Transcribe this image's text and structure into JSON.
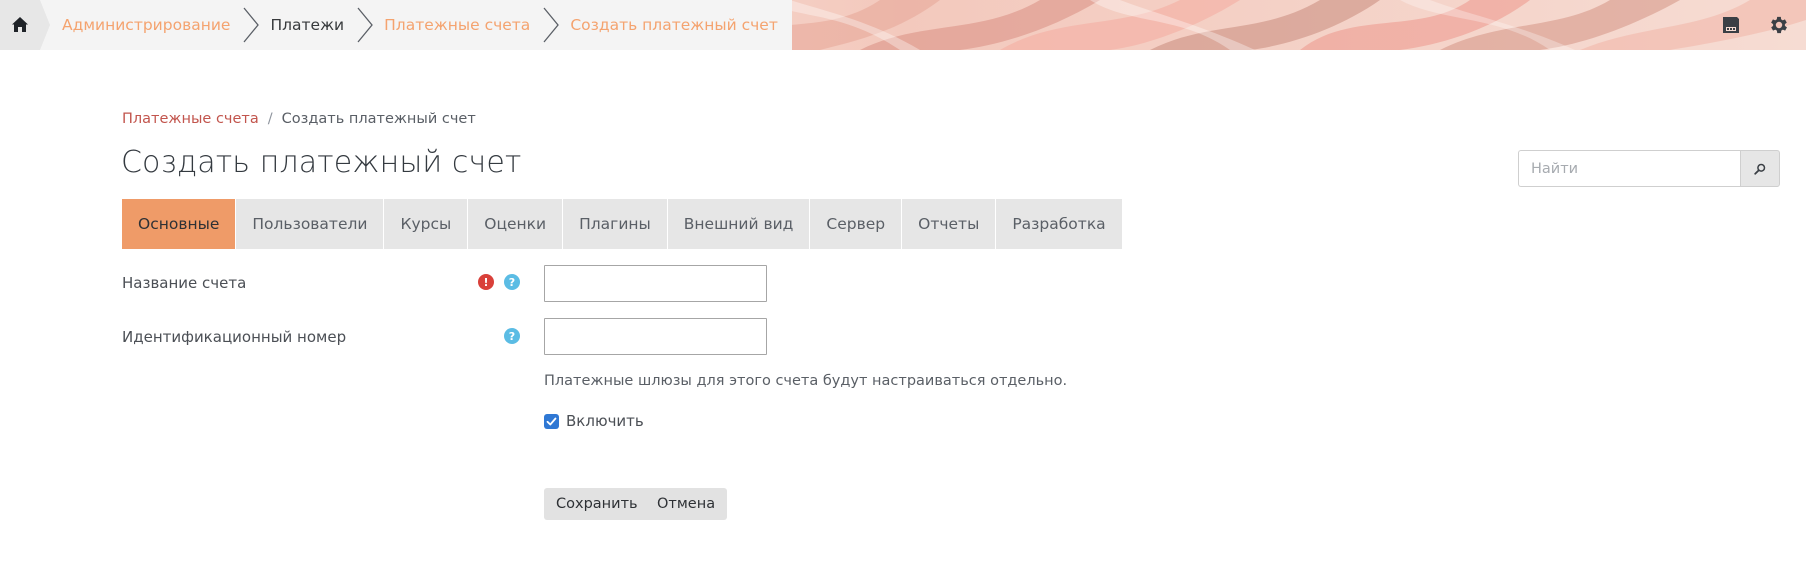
{
  "topbar": {
    "breadcrumbs": [
      {
        "label": "Администрирование",
        "link": true
      },
      {
        "label": "Платежи",
        "link": false
      },
      {
        "label": "Платежные счета",
        "link": true
      },
      {
        "label": "Создать платежный счет",
        "link": true
      }
    ],
    "icons": {
      "home": "home-icon",
      "save": "save-icon",
      "settings": "gear-icon"
    }
  },
  "breadcrumb": {
    "parent": "Платежные счета",
    "separator": "/",
    "current": "Создать платежный счет"
  },
  "page": {
    "title": "Создать платежный счет"
  },
  "search": {
    "placeholder": "Найти",
    "icon": "search-icon"
  },
  "tabs": [
    {
      "label": "Основные",
      "active": true
    },
    {
      "label": "Пользователи",
      "active": false
    },
    {
      "label": "Курсы",
      "active": false
    },
    {
      "label": "Оценки",
      "active": false
    },
    {
      "label": "Плагины",
      "active": false
    },
    {
      "label": "Внешний вид",
      "active": false
    },
    {
      "label": "Сервер",
      "active": false
    },
    {
      "label": "Отчеты",
      "active": false
    },
    {
      "label": "Разработка",
      "active": false
    }
  ],
  "form": {
    "account_name": {
      "label": "Название счета",
      "value": "",
      "required_icon": "!",
      "help_icon": "?"
    },
    "id_number": {
      "label": "Идентификационный номер",
      "value": "",
      "help_icon": "?"
    },
    "note": "Платежные шлюзы для этого счета будут настраиваться отдельно.",
    "enable": {
      "label": "Включить",
      "checked": true
    },
    "save_label": "Сохранить",
    "cancel_label": "Отмена"
  },
  "colors": {
    "accent_tab": "#ef9b68",
    "link": "#f4a36f",
    "breadcrumb_link": "#c2554d",
    "required": "#d9403a",
    "help": "#5bbce4",
    "checkbox": "#2f78d4"
  }
}
